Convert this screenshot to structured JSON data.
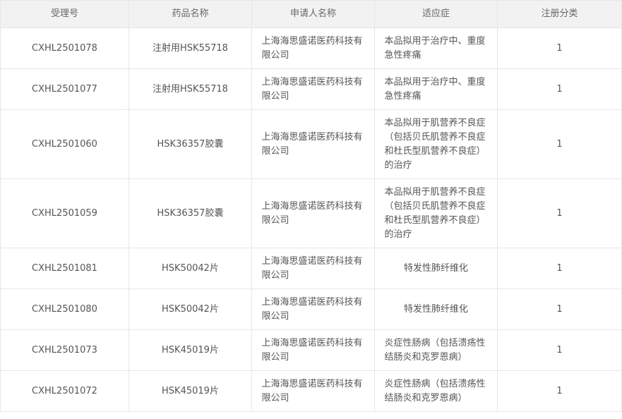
{
  "headers": [
    "受理号",
    "药品名称",
    "申请人名称",
    "适应症",
    "注册分类"
  ],
  "rows": [
    {
      "id": "CXHL2501078",
      "drug": "注射用HSK55718",
      "applicant": "上海海思盛诺医药科技有限公司",
      "indication": "本品拟用于治疗中、重度急性疼痛",
      "category": "1"
    },
    {
      "id": "CXHL2501077",
      "drug": "注射用HSK55718",
      "applicant": "上海海思盛诺医药科技有限公司",
      "indication": "本品拟用于治疗中、重度急性疼痛",
      "category": "1"
    },
    {
      "id": "CXHL2501060",
      "drug": "HSK36357胶囊",
      "applicant": "上海海思盛诺医药科技有限公司",
      "indication": "本品拟用于肌营养不良症（包括贝氏肌营养不良症和杜氏型肌营养不良症）的治疗",
      "category": "1"
    },
    {
      "id": "CXHL2501059",
      "drug": "HSK36357胶囊",
      "applicant": "上海海思盛诺医药科技有限公司",
      "indication": "本品拟用于肌营养不良症（包括贝氏肌营养不良症和杜氏型肌营养不良症）的治疗",
      "category": "1"
    },
    {
      "id": "CXHL2501081",
      "drug": "HSK50042片",
      "applicant": "上海海思盛诺医药科技有限公司",
      "indication": "特发性肺纤维化",
      "category": "1"
    },
    {
      "id": "CXHL2501080",
      "drug": "HSK50042片",
      "applicant": "上海海思盛诺医药科技有限公司",
      "indication": "特发性肺纤维化",
      "category": "1"
    },
    {
      "id": "CXHL2501073",
      "drug": "HSK45019片",
      "applicant": "上海海思盛诺医药科技有限公司",
      "indication": "炎症性肠病（包括溃疡性结肠炎和克罗恩病）",
      "category": "1"
    },
    {
      "id": "CXHL2501072",
      "drug": "HSK45019片",
      "applicant": "上海海思盛诺医药科技有限公司",
      "indication": "炎症性肠病（包括溃疡性结肠炎和克罗恩病）",
      "category": "1"
    }
  ]
}
